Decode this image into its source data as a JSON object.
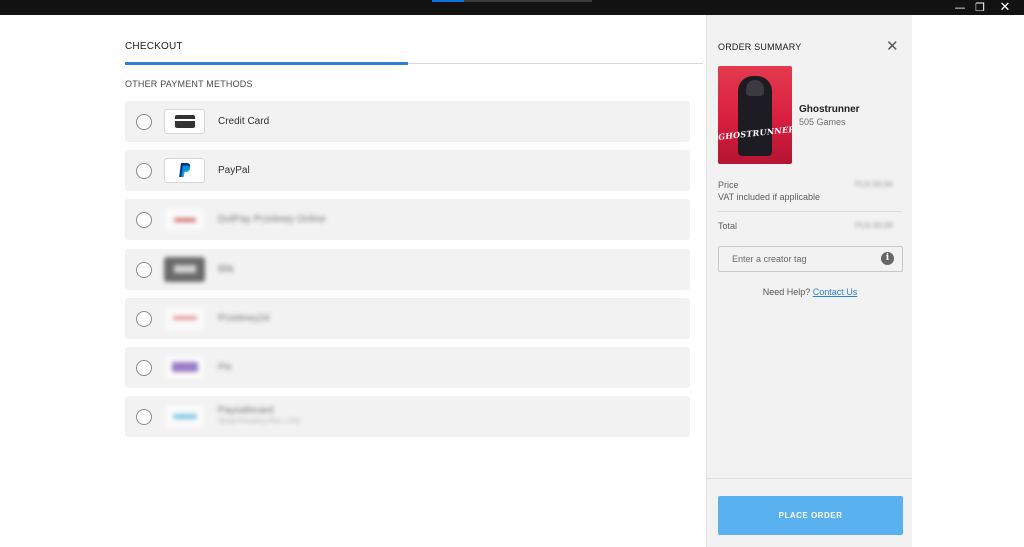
{
  "window": {
    "minimize_glyph": "—",
    "maximize_glyph": "❐",
    "close_glyph": "✕"
  },
  "checkout": {
    "title": "CHECKOUT",
    "section_title": "OTHER PAYMENT METHODS",
    "methods": [
      {
        "label": "Credit Card",
        "icon": "credit-card-icon",
        "obscured": false
      },
      {
        "label": "PayPal",
        "icon": "paypal-icon",
        "obscured": false
      },
      {
        "label": "DotPay Przelewy Online",
        "icon": "dotpay-icon",
        "obscured": true
      },
      {
        "label": "Blik",
        "icon": "blik-icon",
        "obscured": true
      },
      {
        "label": "Przelewy24",
        "icon": "przelewy24-icon",
        "obscured": true
      },
      {
        "label": "Pix",
        "icon": "pix-icon",
        "obscured": true
      },
      {
        "label": "Paysafecard",
        "sublabel": "Nowa Przelewy Plus 1.5%",
        "icon": "paysafecard-icon",
        "obscured": true
      }
    ]
  },
  "summary": {
    "title": "ORDER SUMMARY",
    "close_glyph": "✕",
    "game_title": "Ghostrunner",
    "publisher": "505 Games",
    "cover_title": "GHOSTRUNNER",
    "price_label": "Price",
    "vat_label": "VAT included if applicable",
    "price_value": "PLN 99,99",
    "total_label": "Total",
    "total_value": "PLN 99,99",
    "creator_tag_placeholder": "Enter a creator tag",
    "info_glyph": "i",
    "help_text": "Need Help?",
    "contact_link": "Contact Us",
    "place_order": "PLACE ORDER"
  },
  "colors": {
    "accent": "#2f7fd6",
    "button": "#59b2ef",
    "cover_red": "#d81e3f",
    "paypal_dark": "#003087",
    "paypal_light": "#009cde"
  }
}
